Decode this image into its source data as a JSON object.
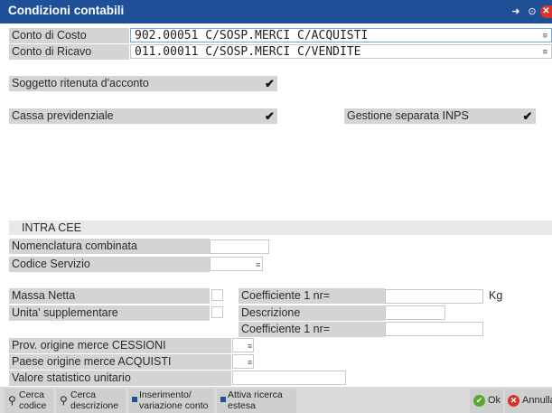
{
  "window": {
    "title": "Condizioni contabili"
  },
  "accounts": {
    "costo_label": "Conto di Costo",
    "costo_value": "902.00051 C/SOSP.MERCI C/ACQUISTI",
    "ricavo_label": "Conto di Ricavo",
    "ricavo_value": "011.00011 C/SOSP.MERCI C/VENDITE"
  },
  "flags": {
    "ritenuta_label": "Soggetto ritenuta d'acconto",
    "cassa_label": "Cassa previdenziale",
    "inps_label": "Gestione separata INPS",
    "check_glyph": "✔"
  },
  "intra": {
    "header": "INTRA CEE",
    "nomenclatura_label": "Nomenclatura combinata",
    "codice_servizio_label": "Codice Servizio",
    "massa_netta_label": "Massa Netta",
    "coeff1_label": "Coefficiente 1 nr=",
    "unit_kg": "Kg",
    "unita_suppl_label": "Unita' supplementare",
    "descrizione_label": "Descrizione",
    "coeff2_label": "Coefficiente 1 nr=",
    "prov_label": "Prov. origine merce CESSIONI",
    "paese_label": "Paese origine merce ACQUISTI",
    "valore_label": "Valore statistico unitario"
  },
  "footer": {
    "cerca_codice_1": "Cerca",
    "cerca_codice_2": "codice",
    "cerca_descr_1": "Cerca",
    "cerca_descr_2": "descrizione",
    "inserimento_1": "Inserimento/",
    "inserimento_2": "variazione conto",
    "attiva_1": "Attiva ricerca",
    "attiva_2": "estesa",
    "ok": "Ok",
    "annulla": "Annulla"
  },
  "colors": {
    "titlebar": "#1f4f96",
    "label_bg": "#d4d4d4",
    "ok_green": "#5aa832",
    "cancel_red": "#d9342b"
  }
}
